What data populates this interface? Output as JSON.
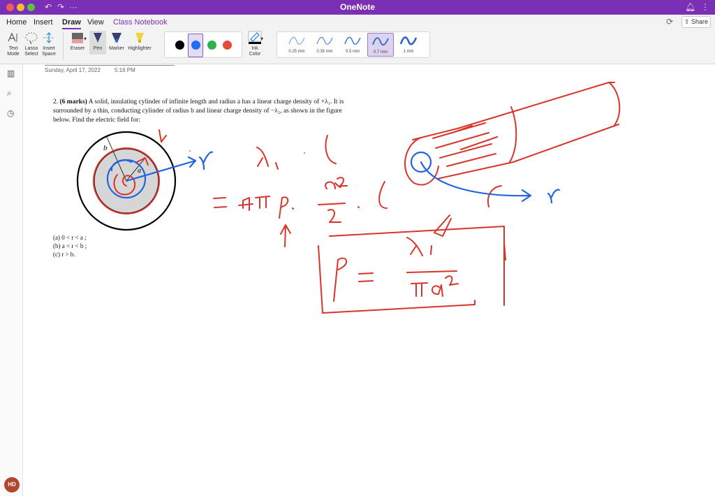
{
  "window": {
    "title": "OneNote"
  },
  "menu": {
    "tabs": [
      "Home",
      "Insert",
      "Draw",
      "View",
      "Class Notebook"
    ],
    "active_tab": "Draw",
    "share_label": "Share"
  },
  "ribbon": {
    "text_mode": [
      "Text",
      "Mode"
    ],
    "lasso_select": [
      "Lasso",
      "Select"
    ],
    "insert_space": [
      "Insert",
      "Space"
    ],
    "eraser": "Eraser",
    "pen": "Pen",
    "marker": "Marker",
    "highlighter": "Highlighter",
    "ink_color": [
      "Ink",
      "Color"
    ],
    "colors": [
      "#000000",
      "#1f6ef5",
      "#2fb24c",
      "#e34a3a"
    ],
    "selected_color": "#1f6ef5",
    "widths": [
      "0.25 mm",
      "0.35 mm",
      "0.5 mm",
      "0.7 mm",
      "1 mm"
    ],
    "selected_width": "0.7 mm"
  },
  "page": {
    "date": "Sunday, April 17, 2022",
    "time": "5:16 PM",
    "problem_number": "2.",
    "marks": "(6 marks)",
    "problem_line1": "A solid, insulating cylinder of infinite length and radius a has a linear charge density of +λ₁.  It is",
    "problem_line2": "surrounded by a thin, conducting cylinder of radius b and linear charge density of −λ₂, as shown in the figure",
    "problem_line3": "below.  Find the electric field for:",
    "part_a": "(a) 0 < r < a ;",
    "part_b": "(b) a < r < b ;",
    "part_c": "(c) r > b.",
    "figure_label_b": "b",
    "figure_label_a": "a"
  },
  "user": {
    "initials": "HD"
  },
  "ink_colors": {
    "red": "#d9342b",
    "blue": "#2463e0"
  }
}
